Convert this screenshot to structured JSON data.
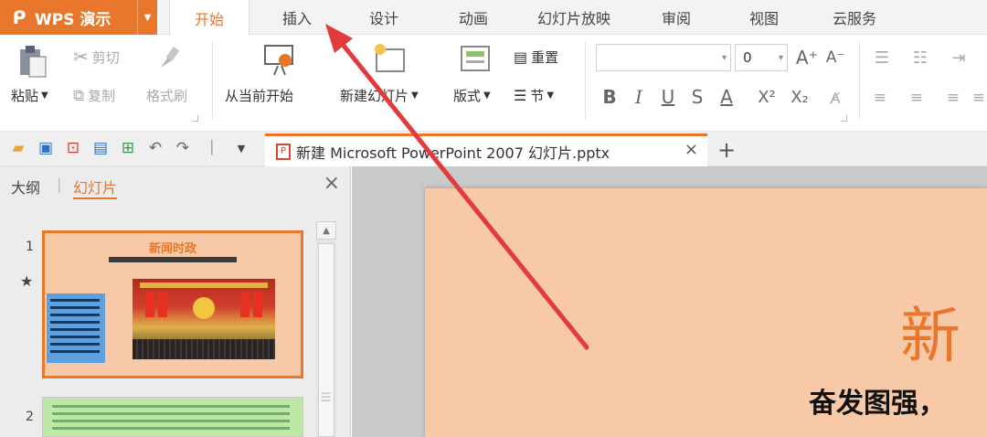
{
  "menubar": {
    "app_name": "WPS 演示",
    "app_logo": "W-logo-icon",
    "tabs": [
      "开始",
      "插入",
      "设计",
      "动画",
      "幻灯片放映",
      "审阅",
      "视图",
      "云服务"
    ],
    "active_tab": "开始"
  },
  "ribbon": {
    "paste": "粘贴",
    "cut": "剪切",
    "copy": "复制",
    "format_painter": "格式刷",
    "from_current": "从当前开始",
    "new_slide": "新建幻灯片",
    "layout": "版式",
    "reset": "重置",
    "section": "节",
    "font_name_value": "",
    "font_size_value": "0",
    "bold": "B",
    "italic": "I",
    "underline": "U",
    "strike": "S",
    "font_color": "A",
    "superscript": "X²",
    "subscript": "X₂",
    "grow_font": "A⁺",
    "shrink_font": "A⁻"
  },
  "doc_tab": {
    "title": "新建 Microsoft PowerPoint 2007 幻灯片.pptx",
    "close": "×",
    "new_tab": "+"
  },
  "left_panel": {
    "tab_outline": "大纲",
    "tab_slides": "幻灯片",
    "close": "×",
    "thumbnails": [
      {
        "number": "1",
        "title": "新闻时政",
        "star": "★"
      },
      {
        "number": "2"
      }
    ]
  },
  "slide": {
    "title": "新",
    "subtitle": "奋发图强，"
  },
  "colors": {
    "accent": "#e8762b",
    "slide_bg": "#f7c9a6",
    "annotation_arrow": "#e23b3b"
  }
}
